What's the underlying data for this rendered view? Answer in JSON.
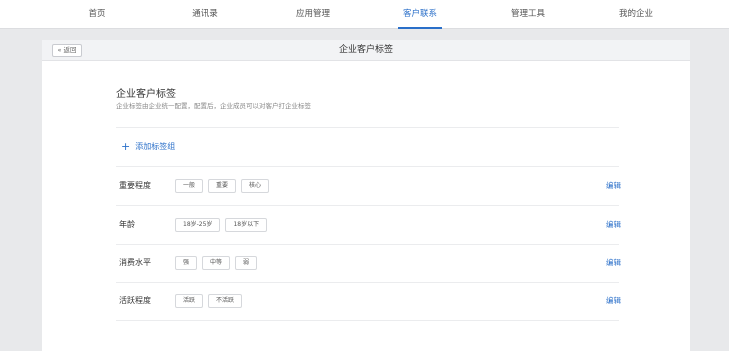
{
  "nav": {
    "items": [
      {
        "label": "首页",
        "active": false
      },
      {
        "label": "通讯录",
        "active": false
      },
      {
        "label": "应用管理",
        "active": false
      },
      {
        "label": "客户联系",
        "active": true
      },
      {
        "label": "管理工具",
        "active": false
      },
      {
        "label": "我的企业",
        "active": false
      }
    ]
  },
  "header": {
    "back_label": "« 返回",
    "title": "企业客户标签"
  },
  "main": {
    "title": "企业客户标签",
    "description": "企业标签由企业统一配置，配置后，企业成员可以对客户打企业标签",
    "add_group_icon": "+",
    "add_group_label": "添加标签组",
    "edit_label": "编辑",
    "groups": [
      {
        "name": "重要程度",
        "tags": [
          "一般",
          "重要",
          "核心"
        ]
      },
      {
        "name": "年龄",
        "tags": [
          "18岁-25岁",
          "18岁以下"
        ]
      },
      {
        "name": "消费水平",
        "tags": [
          "强",
          "中等",
          "弱"
        ]
      },
      {
        "name": "活跃程度",
        "tags": [
          "活跃",
          "不活跃"
        ]
      }
    ]
  },
  "colors": {
    "accent": "#2a6fc9",
    "background": "#e8e9eb"
  }
}
